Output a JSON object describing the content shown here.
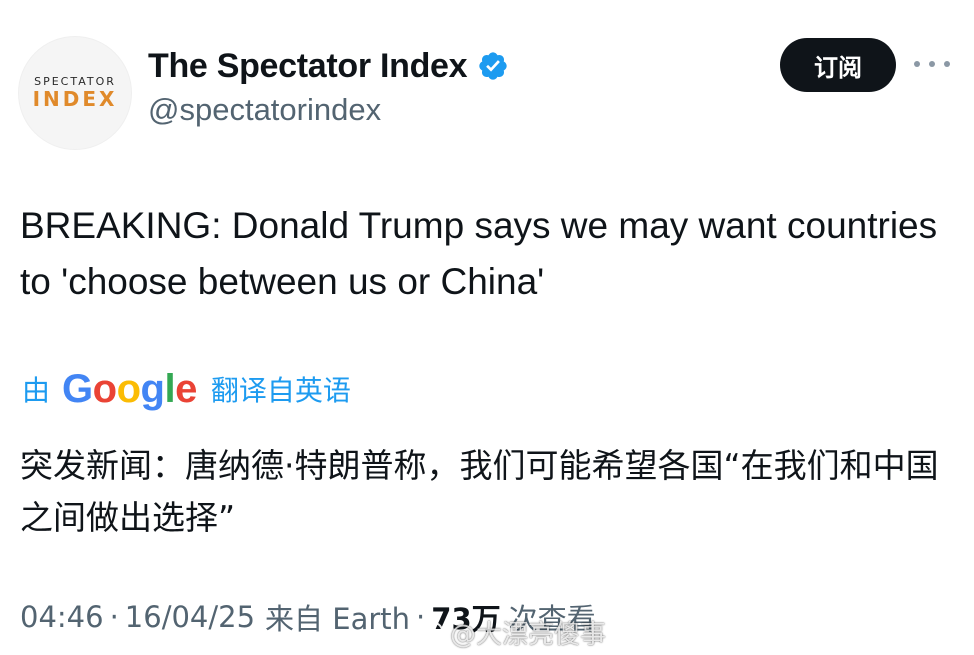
{
  "account": {
    "avatar_top": "SPECTATOR",
    "avatar_bottom": "INDEX",
    "display_name": "The Spectator Index",
    "handle": "@spectatorindex",
    "verified_color": "#1d9bf0"
  },
  "actions": {
    "subscribe_label": "订阅",
    "more_icon": "more-horizontal-icon"
  },
  "tweet": {
    "text": "BREAKING: Donald Trump says we may want countries to 'choose between us or China'"
  },
  "translation": {
    "by_label": "由",
    "provider": "Google",
    "from_label": "翻译自英语",
    "text": "突发新闻：唐纳德·特朗普称，我们可能希望各国“在我们和中国之间做出选择”"
  },
  "meta": {
    "time": "04:46",
    "date": "16/04/25",
    "source": "来自 Earth",
    "views_count": "73万",
    "views_label": "次查看"
  },
  "watermark": {
    "text": "@大漂亮傻事"
  }
}
